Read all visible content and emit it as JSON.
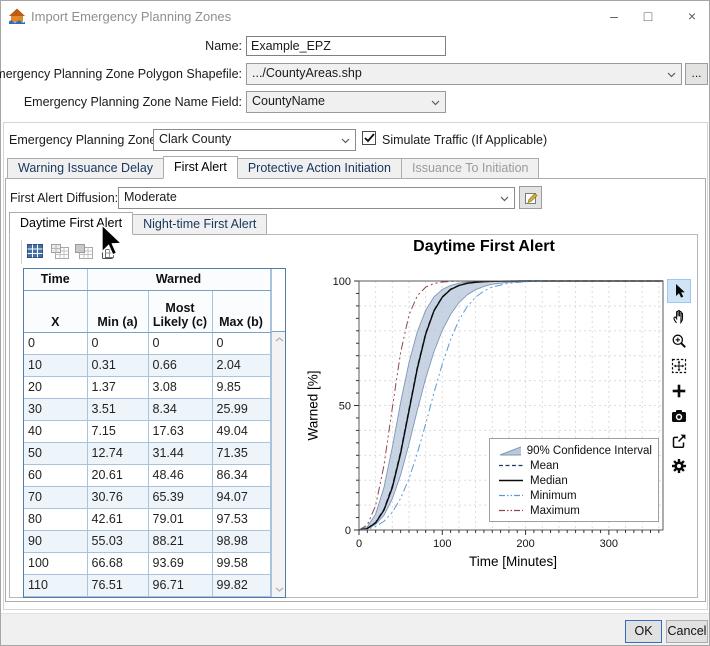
{
  "window": {
    "title": "Import Emergency Planning Zones",
    "minimize_glyph": "–",
    "maximize_glyph": "□",
    "close_glyph": "×",
    "app_icon": "house-flood-icon"
  },
  "form": {
    "name_label": "Name:",
    "name_value": "Example_EPZ",
    "shapefile_label": "Emergency Planning Zone Polygon Shapefile:",
    "shapefile_value": ".../CountyAreas.shp",
    "browse_label": "...",
    "name_field_label": "Emergency Planning Zone Name Field:",
    "name_field_value": "CountyName",
    "epz_label": "Emergency Planning Zone:",
    "epz_value": "Clark County",
    "simulate_traffic_label": "Simulate Traffic (If Applicable)",
    "simulate_traffic_checked": true
  },
  "tabs": [
    {
      "label": "Warning Issuance Delay",
      "state": "normal"
    },
    {
      "label": "First Alert",
      "state": "selected"
    },
    {
      "label": "Protective Action Initiation",
      "state": "normal"
    },
    {
      "label": "Issuance To Initiation",
      "state": "disabled"
    }
  ],
  "first_alert": {
    "diffusion_label": "First Alert Diffusion:",
    "diffusion_value": "Moderate"
  },
  "subtabs": [
    {
      "label": "Daytime First Alert",
      "state": "selected"
    },
    {
      "label": "Night-time First Alert",
      "state": "normal"
    }
  ],
  "table_toolbar_icons": [
    "table-grid-icon",
    "insert-table-icon",
    "copy-table-icon",
    "paste-clipboard-icon"
  ],
  "chart_toolbar_icons": [
    "pointer-icon",
    "pan-hand-icon",
    "zoom-in-icon",
    "fit-extents-icon",
    "crosshair-plus-icon",
    "camera-icon",
    "export-icon",
    "settings-gear-icon"
  ],
  "table": {
    "group_headers": [
      {
        "label": "Time",
        "span": 1
      },
      {
        "label": "Warned",
        "span": 3
      }
    ],
    "columns": [
      "X",
      "Min (a)",
      "Most Likely (c)",
      "Max (b)"
    ],
    "rows": [
      [
        "0",
        "0",
        "0",
        "0"
      ],
      [
        "10",
        "0.31",
        "0.66",
        "2.04"
      ],
      [
        "20",
        "1.37",
        "3.08",
        "9.85"
      ],
      [
        "30",
        "3.51",
        "8.34",
        "25.99"
      ],
      [
        "40",
        "7.15",
        "17.63",
        "49.04"
      ],
      [
        "50",
        "12.74",
        "31.44",
        "71.35"
      ],
      [
        "60",
        "20.61",
        "48.46",
        "86.34"
      ],
      [
        "70",
        "30.76",
        "65.39",
        "94.07"
      ],
      [
        "80",
        "42.61",
        "79.01",
        "97.53"
      ],
      [
        "90",
        "55.03",
        "88.21",
        "98.98"
      ],
      [
        "100",
        "66.68",
        "93.69",
        "99.58"
      ],
      [
        "110",
        "76.51",
        "96.71",
        "99.82"
      ]
    ]
  },
  "chart_data": {
    "type": "line",
    "title": "Daytime First Alert",
    "xlabel": "Time [Minutes]",
    "ylabel": "Warned [%]",
    "xlim": [
      0,
      365
    ],
    "ylim": [
      0,
      100
    ],
    "xticks": [
      0,
      100,
      200,
      300
    ],
    "yticks": [
      0,
      50,
      100
    ],
    "grid": {
      "x_step": 20,
      "y_step": 10
    },
    "legend_position": "lower right inset",
    "x": [
      0,
      10,
      20,
      30,
      40,
      50,
      60,
      70,
      80,
      90,
      100,
      110,
      120,
      130,
      140,
      150,
      160,
      180,
      200,
      220,
      250,
      300,
      365
    ],
    "series": [
      {
        "name": "90% Confidence Interval",
        "type": "band",
        "fill": "#b9c8dc",
        "edge": "#8096b2",
        "upper": [
          0,
          1.3,
          6.4,
          17.1,
          33.2,
          51.2,
          67.2,
          79.6,
          88.2,
          93.6,
          96.6,
          98.2,
          99.1,
          99.55,
          99.8,
          99.9,
          99.95,
          100,
          100,
          100,
          100,
          100,
          100
        ],
        "lower": [
          0,
          0.48,
          2.2,
          5.9,
          12.5,
          22.1,
          34.5,
          48.1,
          60.8,
          71.6,
          80.2,
          86.6,
          91.3,
          94.5,
          96.5,
          97.8,
          98.7,
          99.5,
          99.8,
          99.95,
          100,
          100,
          100
        ]
      },
      {
        "name": "Mean",
        "type": "line",
        "color": "#1f3864",
        "dash": "5 3",
        "width": 1.2,
        "values": [
          0,
          0.66,
          3.08,
          8.34,
          17.63,
          31.44,
          48.46,
          65.39,
          79.01,
          88.21,
          93.69,
          96.71,
          98.25,
          99.1,
          99.55,
          99.78,
          99.89,
          99.97,
          100,
          100,
          100,
          100,
          100
        ]
      },
      {
        "name": "Median",
        "type": "line",
        "color": "#0a0a0a",
        "dash": "",
        "width": 1.4,
        "values": [
          0,
          0.6,
          2.9,
          8.0,
          17.0,
          30.8,
          47.8,
          64.8,
          78.6,
          88.0,
          93.5,
          96.6,
          98.2,
          99.05,
          99.5,
          99.75,
          99.88,
          99.97,
          100,
          100,
          100,
          100,
          100
        ]
      },
      {
        "name": "Minimum",
        "type": "line",
        "color": "#5b9bd5",
        "dash": "8 3 2 3 2 3",
        "width": 1,
        "values": [
          0,
          0.31,
          1.37,
          3.51,
          7.15,
          12.74,
          20.61,
          30.76,
          42.61,
          55.03,
          66.68,
          76.51,
          84.3,
          89.8,
          93.5,
          96.0,
          97.6,
          99.1,
          99.7,
          99.9,
          100,
          100,
          100
        ]
      },
      {
        "name": "Maximum",
        "type": "line",
        "color": "#8c4652",
        "dash": "8 3 2 3 2 3",
        "width": 1,
        "values": [
          0,
          2.04,
          9.85,
          25.99,
          49.04,
          71.35,
          86.34,
          94.07,
          97.53,
          98.98,
          99.58,
          99.82,
          99.92,
          99.96,
          99.98,
          99.99,
          100,
          100,
          100,
          100,
          100,
          100,
          100
        ]
      }
    ]
  },
  "footer": {
    "ok_label": "OK",
    "cancel_label": "Cancel"
  }
}
